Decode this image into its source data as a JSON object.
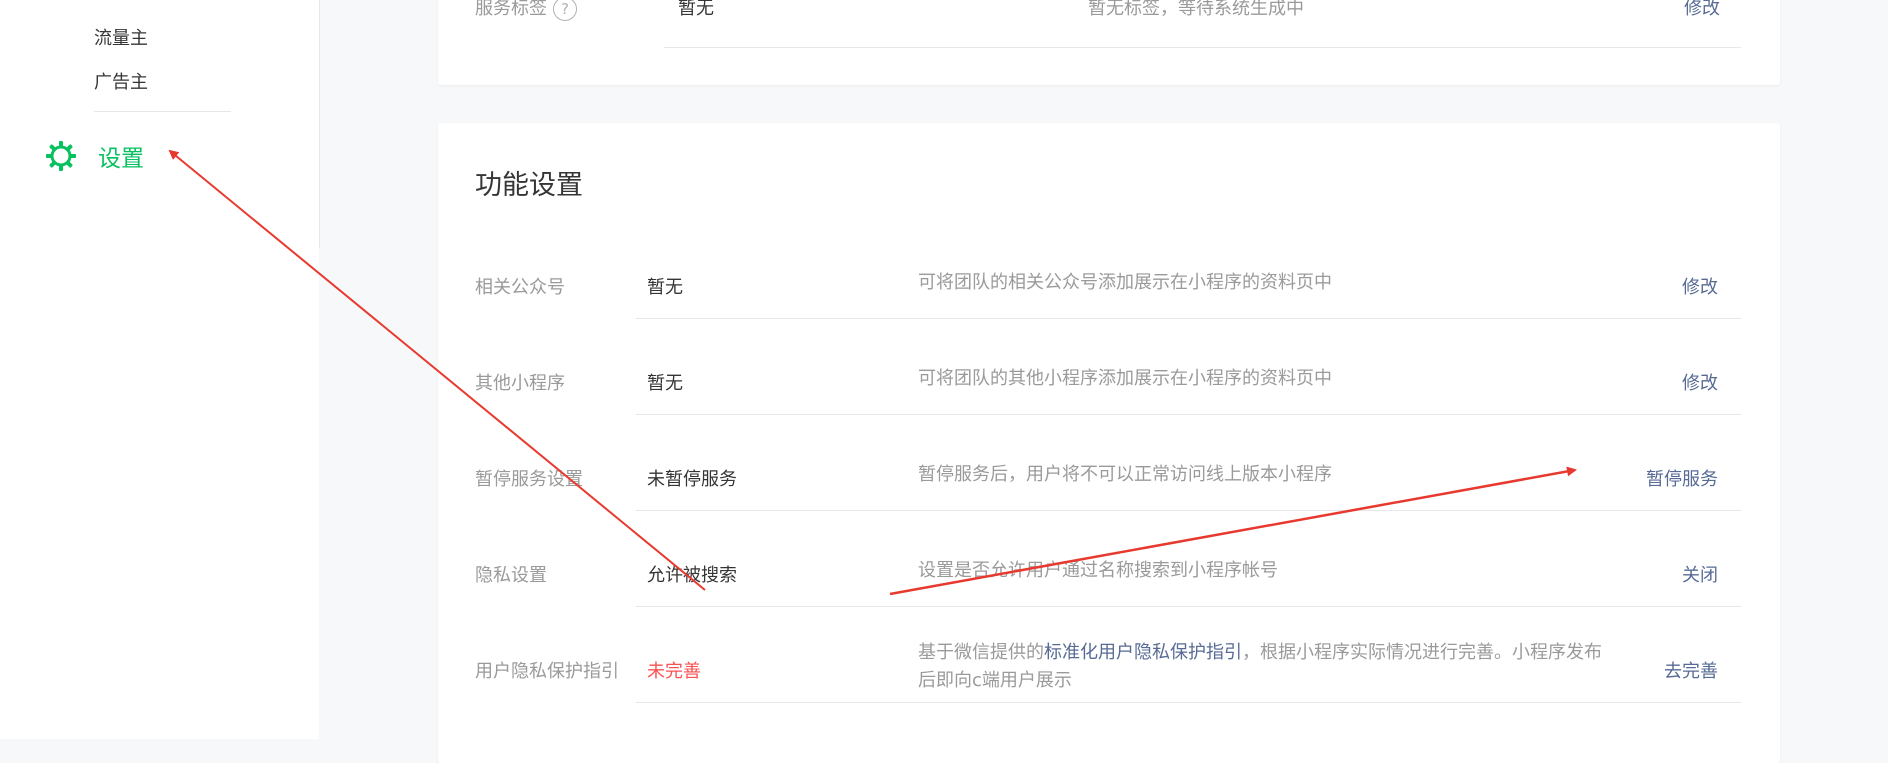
{
  "sidebar": {
    "items": [
      {
        "label": "流量主"
      },
      {
        "label": "广告主"
      }
    ],
    "settings_label": "设置"
  },
  "top_card": {
    "label": "服务标签",
    "value": "暂无",
    "desc": "暂无标签，等待系统生成中",
    "action": "修改"
  },
  "function_settings": {
    "title": "功能设置",
    "rows": [
      {
        "label": "相关公众号",
        "value": "暂无",
        "desc": "可将团队的相关公众号添加展示在小程序的资料页中",
        "action": "修改"
      },
      {
        "label": "其他小程序",
        "value": "暂无",
        "desc": "可将团队的其他小程序添加展示在小程序的资料页中",
        "action": "修改"
      },
      {
        "label": "暂停服务设置",
        "value": "未暂停服务",
        "desc": "暂停服务后，用户将不可以正常访问线上版本小程序",
        "action": "暂停服务"
      },
      {
        "label": "隐私设置",
        "value": "允许被搜索",
        "desc": "设置是否允许用户通过名称搜索到小程序帐号",
        "action": "关闭"
      },
      {
        "label": "用户隐私保护指引",
        "value": "未完善",
        "desc_prefix": "基于微信提供的",
        "desc_link": "标准化用户隐私保护指引",
        "desc_suffix": "，根据小程序实际情况进行完善。小程序发布后即向c端用户展示",
        "action": "去完善"
      }
    ]
  },
  "colors": {
    "accent_green": "#07c160",
    "link_blue": "#576b95",
    "warn_red": "#fa5151",
    "annotation_red": "#e8392f"
  }
}
